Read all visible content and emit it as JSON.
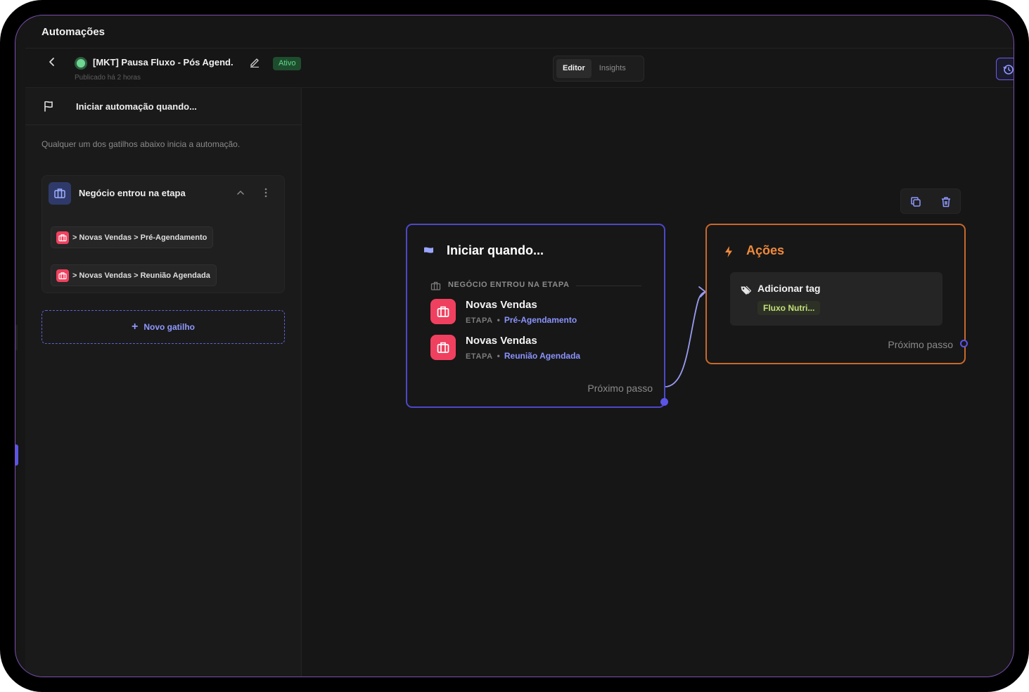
{
  "app": {
    "title": "Automações"
  },
  "flow": {
    "name": "[MKT] Pausa Fluxo - Pós Agend.",
    "status": "Ativo",
    "published": "Publicado há 2 horas",
    "status_color": "#61d98a"
  },
  "tabs": [
    {
      "label": "Editor",
      "active": true
    },
    {
      "label": "Insights",
      "active": false
    }
  ],
  "left_panel": {
    "title": "Iniciar automação quando...",
    "description": "Qualquer um dos gatilhos abaixo inicia a automação.",
    "trigger": {
      "title": "Negócio entrou na etapa",
      "chips": [
        {
          "text": "> Novas Vendas > Pré-Agendamento"
        },
        {
          "text": "> Novas Vendas > Reunião Agendada"
        }
      ]
    },
    "new_trigger_label": "Novo gatilho"
  },
  "start_node": {
    "title": "Iniciar quando...",
    "category": "NEGÓCIO ENTROU NA ETAPA",
    "items": [
      {
        "name": "Novas Vendas",
        "label": "ETAPA",
        "stage": "Pré-Agendamento"
      },
      {
        "name": "Novas Vendas",
        "label": "ETAPA",
        "stage": "Reunião Agendada"
      }
    ],
    "next_label": "Próximo passo",
    "accent": "#4d48c8"
  },
  "actions_node": {
    "title": "Ações",
    "action": {
      "title": "Adicionar tag",
      "tag": "Fluxo Nutri..."
    },
    "next_label": "Próximo passo",
    "accent": "#c8682c"
  },
  "icons": {
    "back": "chevron-left-icon",
    "edit": "pencil-icon",
    "history": "history-icon",
    "flag": "flag-icon",
    "briefcase": "briefcase-icon",
    "chevron": "chevron-up-icon",
    "more": "more-vertical-icon",
    "plus": "plus-icon",
    "copy": "copy-icon",
    "delete": "trash-icon",
    "bolt": "bolt-icon",
    "tag": "tag-icon"
  }
}
